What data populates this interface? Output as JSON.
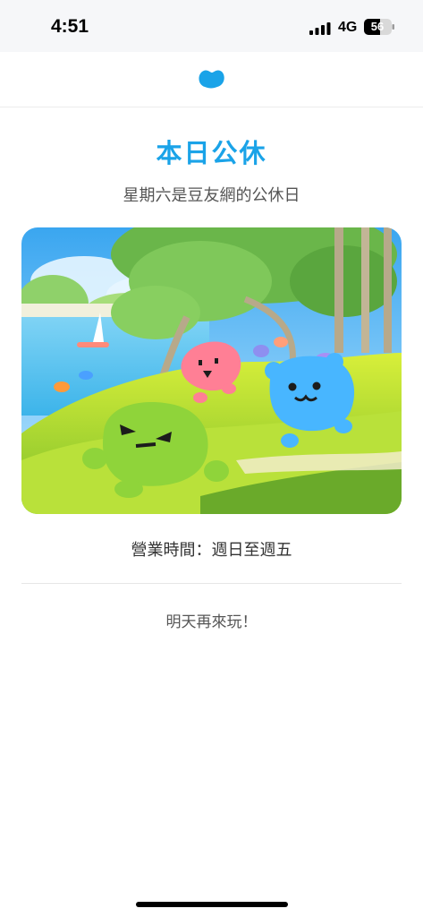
{
  "status_bar": {
    "time": "4:51",
    "network": "4G",
    "battery_level": "56"
  },
  "header": {
    "logo": "blue-bean-logo-icon"
  },
  "main": {
    "title": "本日公休",
    "subtitle": "星期六是豆友網的公休日",
    "illustration": "bean-mascots-park-illustration",
    "hours": "營業時間：週日至週五",
    "closing_message": "明天再來玩！"
  },
  "colors": {
    "accent": "#1aa3e8",
    "status_bar_bg": "#f6f7f9"
  }
}
